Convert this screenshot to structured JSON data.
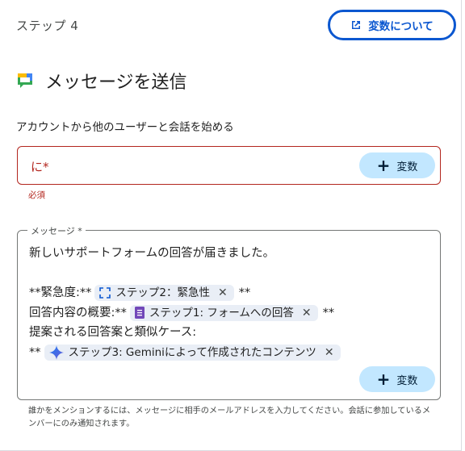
{
  "header": {
    "step_label": "ステップ 4",
    "variables_button": "変数について"
  },
  "action": {
    "title": "メッセージを送信",
    "description": "アカウントから他のユーザーと会話を始める"
  },
  "to_field": {
    "label": "に*",
    "add_variable": "変数",
    "error": "必須"
  },
  "message_field": {
    "label": "メッセージ *",
    "line1": "新しいサポートフォームの回答が届きました。",
    "line3_prefix": "**緊急度:**",
    "chip_urgency": "ステップ2：緊急性",
    "line3_suffix": "**",
    "line4_prefix": "回答内容の概要:**",
    "chip_form": "ステップ1: フォームへの回答",
    "line4_suffix": "**",
    "line5": "提案される回答案と類似ケース:",
    "line6_prefix": "**",
    "chip_gemini": "ステップ3: Geminiによって作成されたコンテンツ",
    "add_variable": "変数"
  },
  "helper_text": "誰かをメンションするには、メッセージに相手のメールアドレスを入力してください。会話に参加しているメンバーにのみ通知されます。",
  "colors": {
    "accent": "#0b57d0",
    "error": "#b3261e",
    "chip_bg": "#e9eef6",
    "tonal_button": "#c2e7ff"
  }
}
